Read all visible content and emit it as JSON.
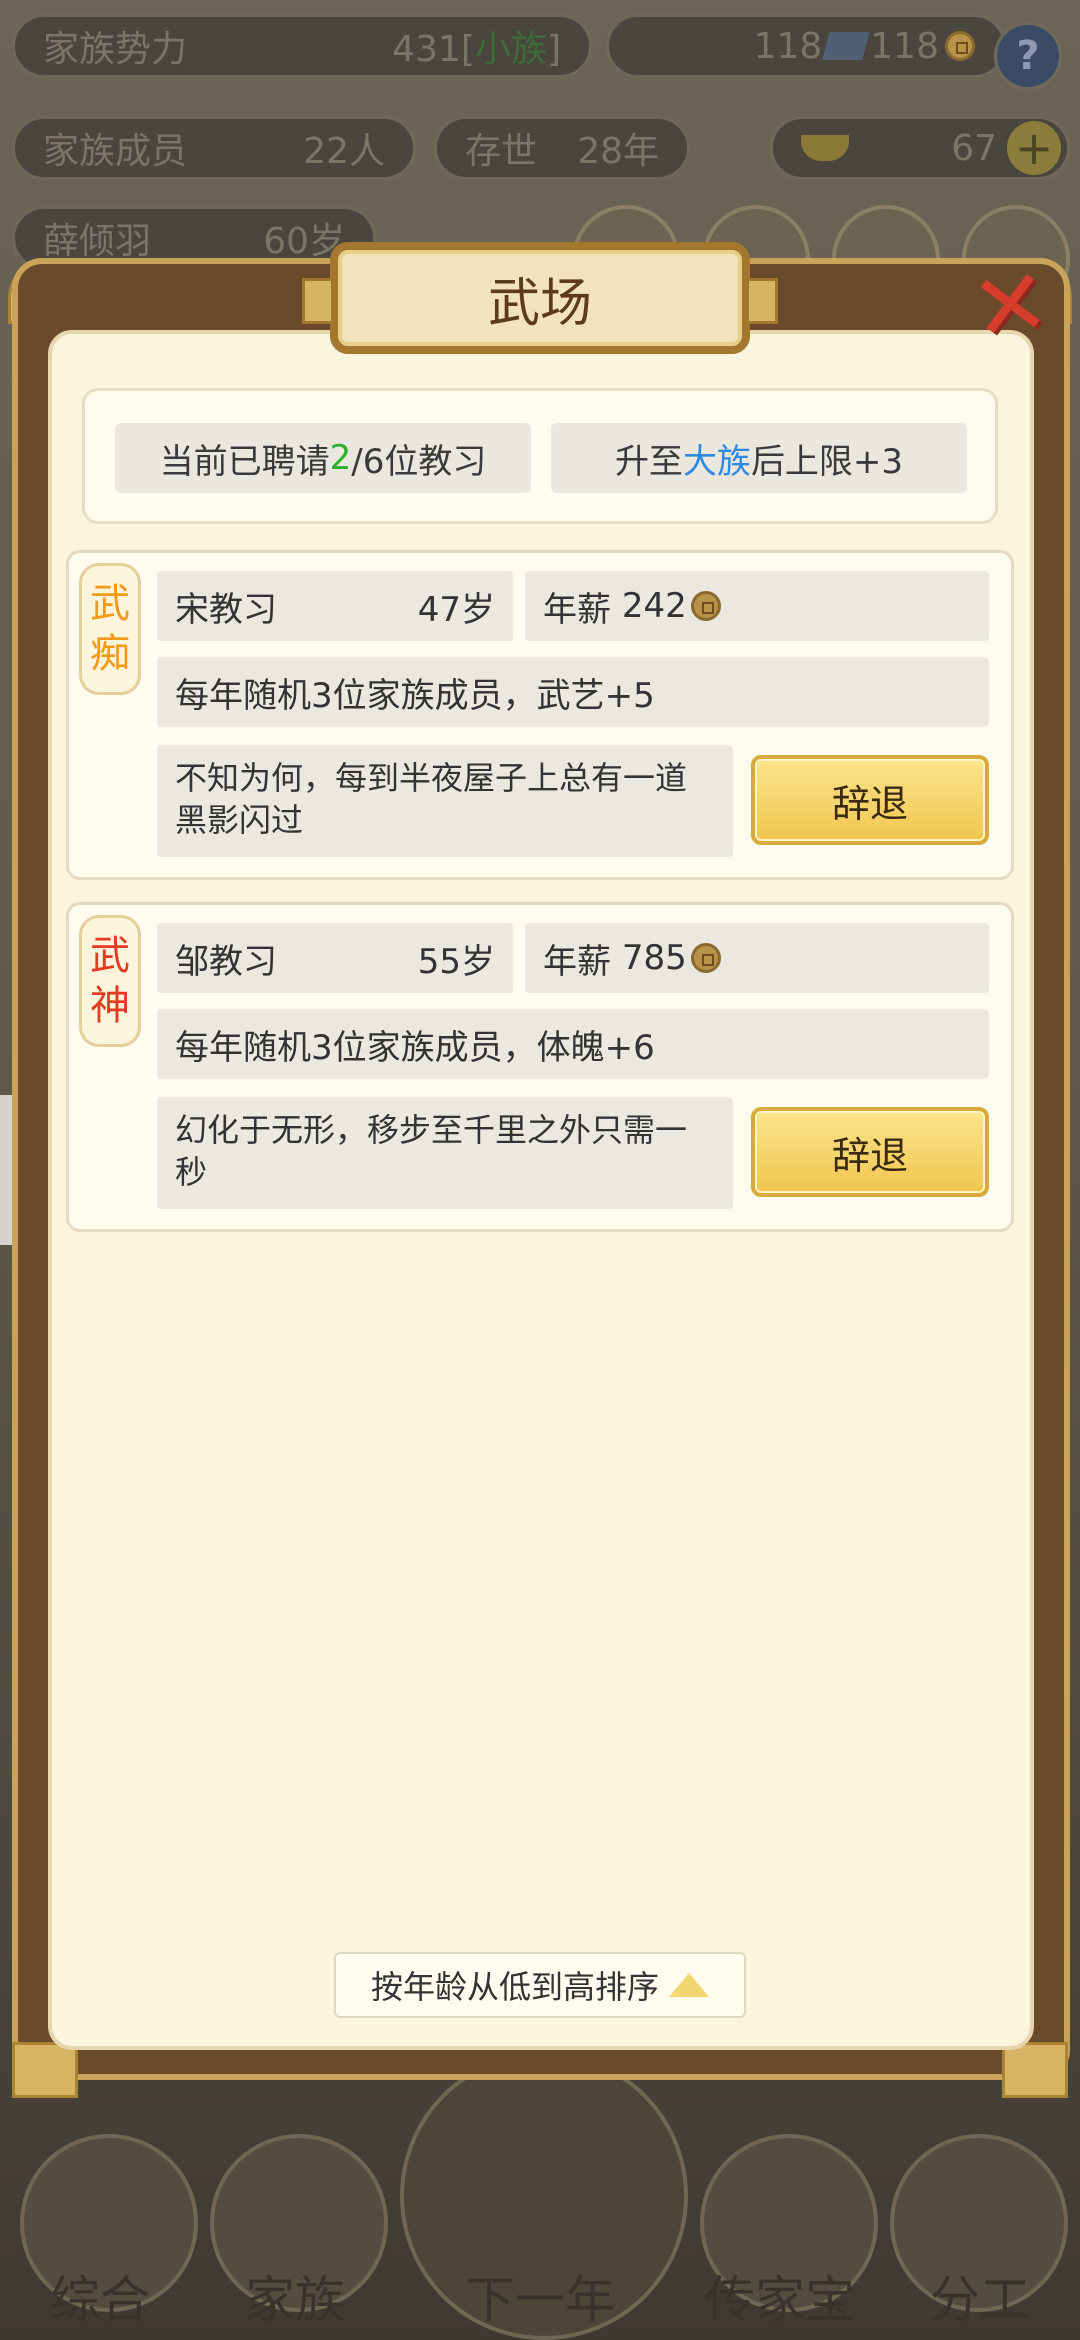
{
  "hud": {
    "family_power_label": "家族势力",
    "family_power_value": "431",
    "family_power_bracket_open": "[",
    "family_power_rank": "小族",
    "family_power_bracket_close": "]",
    "silver_value": "118",
    "coin_value": "118",
    "help_label": "?",
    "members_label": "家族成员",
    "members_value": "22人",
    "existence_label": "存世",
    "existence_value": "28年",
    "gold_value": "67",
    "leader_name": "薛倾羽",
    "leader_age": "60岁"
  },
  "modal": {
    "title": "武场",
    "hired_prefix": "当前已聘请",
    "hired_count": "2",
    "hired_suffix": "/6位教习",
    "upgrade_prefix": "升至",
    "upgrade_rank": "大族",
    "upgrade_suffix": "后上限+3",
    "teachers": [
      {
        "tag_top": "武",
        "tag_bottom": "痴",
        "name": "宋教习",
        "age": "47岁",
        "salary_label": "年薪",
        "salary": "242",
        "effect": "每年随机3位家族成员，武艺+5",
        "description": "不知为何，每到半夜屋子上总有一道黑影闪过",
        "dismiss_label": "辞退"
      },
      {
        "tag_top": "武",
        "tag_bottom": "神",
        "name": "邹教习",
        "age": "55岁",
        "salary_label": "年薪",
        "salary": "785",
        "effect": "每年随机3位家族成员，体魄+6",
        "description": "幻化于无形，移步至千里之外只需一秒",
        "dismiss_label": "辞退"
      }
    ],
    "sort_label": "按年龄从低到高排序"
  },
  "nav": {
    "items": [
      "综合",
      "家族",
      "下一年",
      "传家宝",
      "分工"
    ]
  },
  "colors": {
    "accent_gold": "#f1c64f",
    "tag_orange": "#f29a18",
    "tag_red": "#e23a23",
    "count_green": "#2bb02b",
    "rank_blue": "#2d8ae0"
  }
}
